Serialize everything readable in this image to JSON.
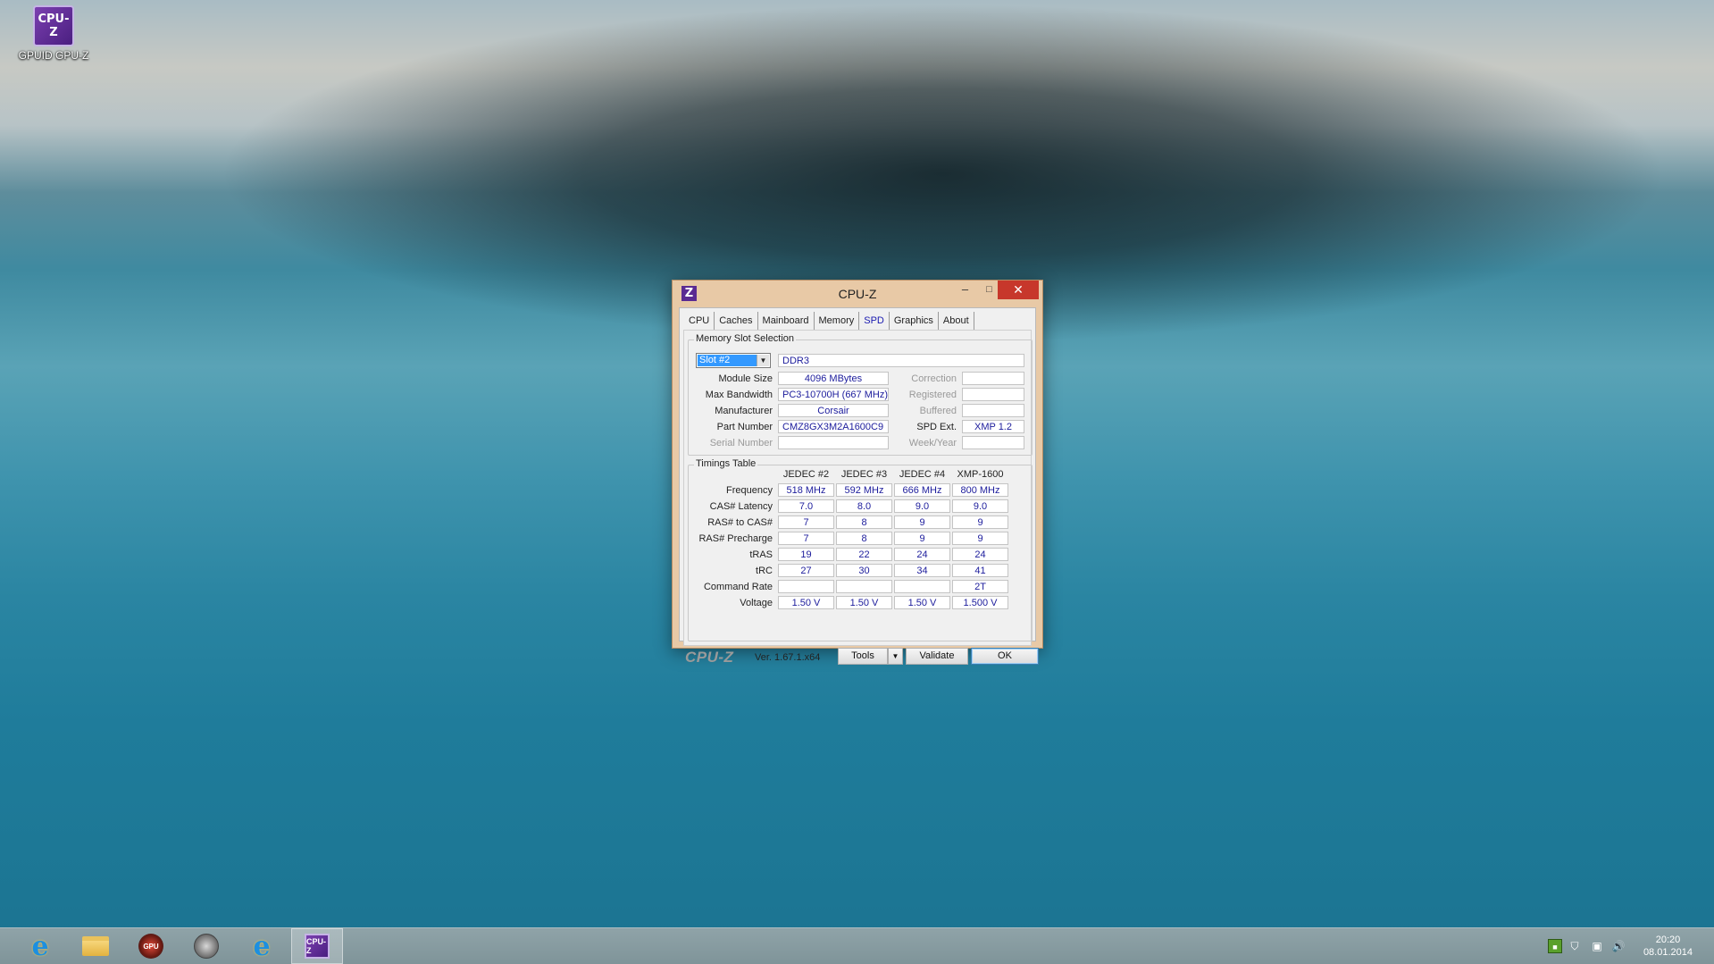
{
  "desktop": {
    "icon_label": "GPUID GPU-Z",
    "icon_text": "CPU-Z"
  },
  "window": {
    "title": "CPU-Z",
    "app_icon": "Z",
    "controls": {
      "minimize": "–",
      "maximize": "□",
      "close": "✕"
    },
    "tabs": [
      {
        "label": "CPU"
      },
      {
        "label": "Caches"
      },
      {
        "label": "Mainboard"
      },
      {
        "label": "Memory"
      },
      {
        "label": "SPD"
      },
      {
        "label": "Graphics"
      },
      {
        "label": "About"
      }
    ],
    "active_tab": "SPD"
  },
  "spd": {
    "group_title": "Memory Slot Selection",
    "slot": "Slot #2",
    "mem_type": "DDR3",
    "labels": {
      "module_size": "Module Size",
      "max_bandwidth": "Max Bandwidth",
      "manufacturer": "Manufacturer",
      "part_number": "Part Number",
      "serial_number": "Serial Number",
      "correction": "Correction",
      "registered": "Registered",
      "buffered": "Buffered",
      "spd_ext": "SPD Ext.",
      "week_year": "Week/Year"
    },
    "values": {
      "module_size": "4096 MBytes",
      "max_bandwidth": "PC3-10700H (667 MHz)",
      "manufacturer": "Corsair",
      "part_number": "CMZ8GX3M2A1600C9",
      "serial_number": "",
      "correction": "",
      "registered": "",
      "buffered": "",
      "spd_ext": "XMP 1.2",
      "week_year": ""
    }
  },
  "timings": {
    "group_title": "Timings Table",
    "columns": [
      "JEDEC #2",
      "JEDEC #3",
      "JEDEC #4",
      "XMP-1600"
    ],
    "rows": [
      {
        "label": "Frequency",
        "values": [
          "518 MHz",
          "592 MHz",
          "666 MHz",
          "800 MHz"
        ]
      },
      {
        "label": "CAS# Latency",
        "values": [
          "7.0",
          "8.0",
          "9.0",
          "9.0"
        ]
      },
      {
        "label": "RAS# to CAS#",
        "values": [
          "7",
          "8",
          "9",
          "9"
        ]
      },
      {
        "label": "RAS# Precharge",
        "values": [
          "7",
          "8",
          "9",
          "9"
        ]
      },
      {
        "label": "tRAS",
        "values": [
          "19",
          "22",
          "24",
          "24"
        ]
      },
      {
        "label": "tRC",
        "values": [
          "27",
          "30",
          "34",
          "41"
        ]
      },
      {
        "label": "Command Rate",
        "values": [
          "",
          "",
          "",
          "2T"
        ]
      },
      {
        "label": "Voltage",
        "values": [
          "1.50 V",
          "1.50 V",
          "1.50 V",
          "1.500 V"
        ]
      }
    ]
  },
  "footer": {
    "brand": "CPU-Z",
    "version": "Ver. 1.67.1.x64",
    "tools": "Tools",
    "validate": "Validate",
    "ok": "OK"
  },
  "taskbar": {
    "items": [
      {
        "name": "internet-explorer",
        "icon": "e"
      },
      {
        "name": "file-explorer",
        "icon": "folder-icon"
      },
      {
        "name": "gpu-tweak",
        "icon": "GPU"
      },
      {
        "name": "media-player",
        "icon": "media-icon"
      },
      {
        "name": "internet-explorer-2",
        "icon": "e"
      },
      {
        "name": "cpu-z",
        "icon": "CPU-Z"
      }
    ],
    "clock_time": "20:20",
    "clock_date": "08.01.2014"
  }
}
